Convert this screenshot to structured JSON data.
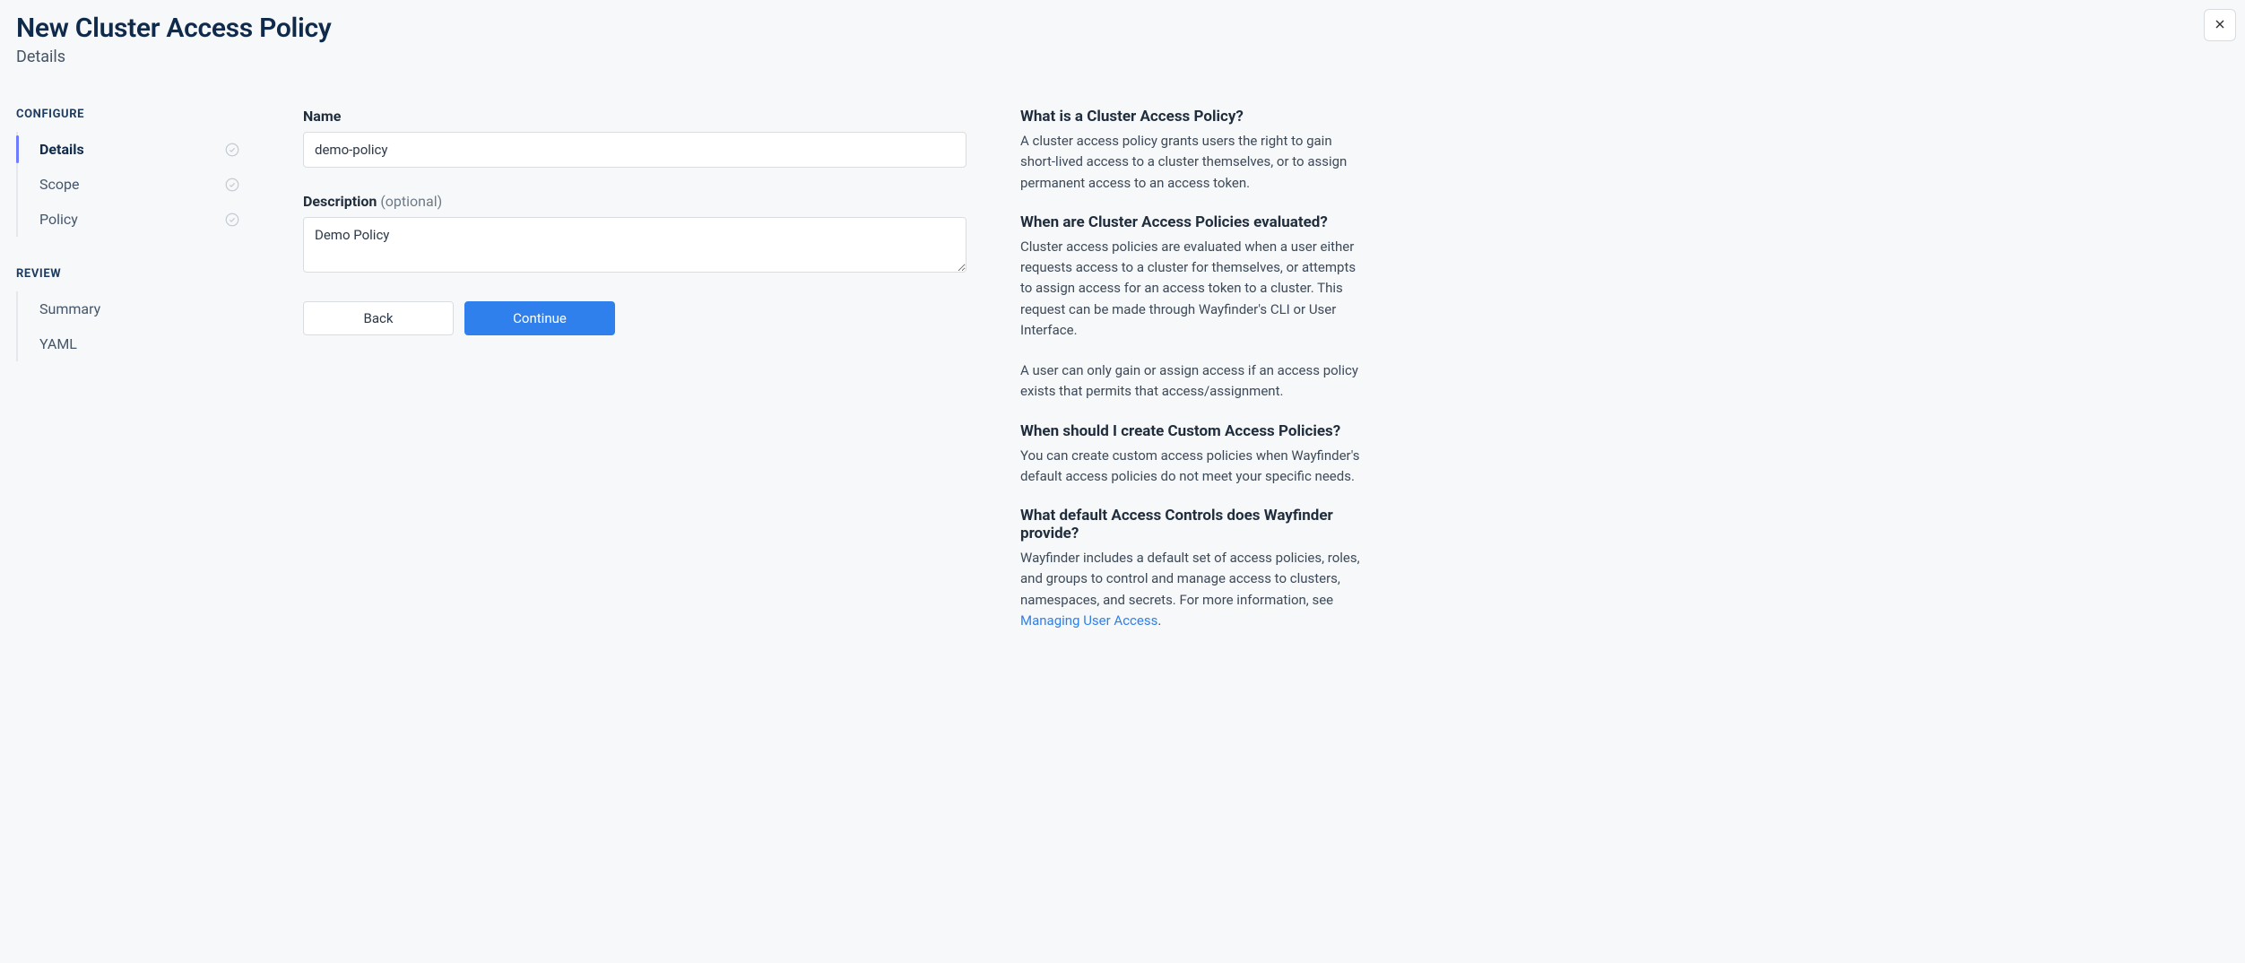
{
  "header": {
    "title": "New Cluster Access Policy",
    "subtitle": "Details"
  },
  "sidebar": {
    "groups": [
      {
        "title": "CONFIGURE",
        "items": [
          {
            "label": "Details",
            "active": true,
            "status": true
          },
          {
            "label": "Scope",
            "active": false,
            "status": true
          },
          {
            "label": "Policy",
            "active": false,
            "status": true
          }
        ]
      },
      {
        "title": "REVIEW",
        "items": [
          {
            "label": "Summary",
            "active": false,
            "status": false
          },
          {
            "label": "YAML",
            "active": false,
            "status": false
          }
        ]
      }
    ]
  },
  "form": {
    "name_label": "Name",
    "name_value": "demo-policy",
    "desc_label": "Description",
    "desc_optional": "(optional)",
    "desc_value": "Demo Policy",
    "back_label": "Back",
    "continue_label": "Continue"
  },
  "help": {
    "q1_title": "What is a Cluster Access Policy?",
    "q1_body": "A cluster access policy grants users the right to gain short-lived access to a cluster themselves, or to assign permanent access to an access token.",
    "q2_title": "When are Cluster Access Policies evaluated?",
    "q2_body1": "Cluster access policies are evaluated when a user either requests access to a cluster for themselves, or attempts to assign access for an access token to a cluster. This request can be made through Wayfinder's CLI or User Interface.",
    "q2_body2": "A user can only gain or assign access if an access policy exists that permits that access/assignment.",
    "q3_title": "When should I create Custom Access Policies?",
    "q3_body": "You can create custom access policies when Wayfinder's default access policies do not meet your specific needs.",
    "q4_title": "What default Access Controls does Wayfinder provide?",
    "q4_body_pre": "Wayfinder includes a default set of access policies, roles, and groups to control and manage access to clusters, namespaces, and secrets. For more information, see ",
    "q4_link_text": "Managing User Access",
    "q4_body_post": "."
  }
}
